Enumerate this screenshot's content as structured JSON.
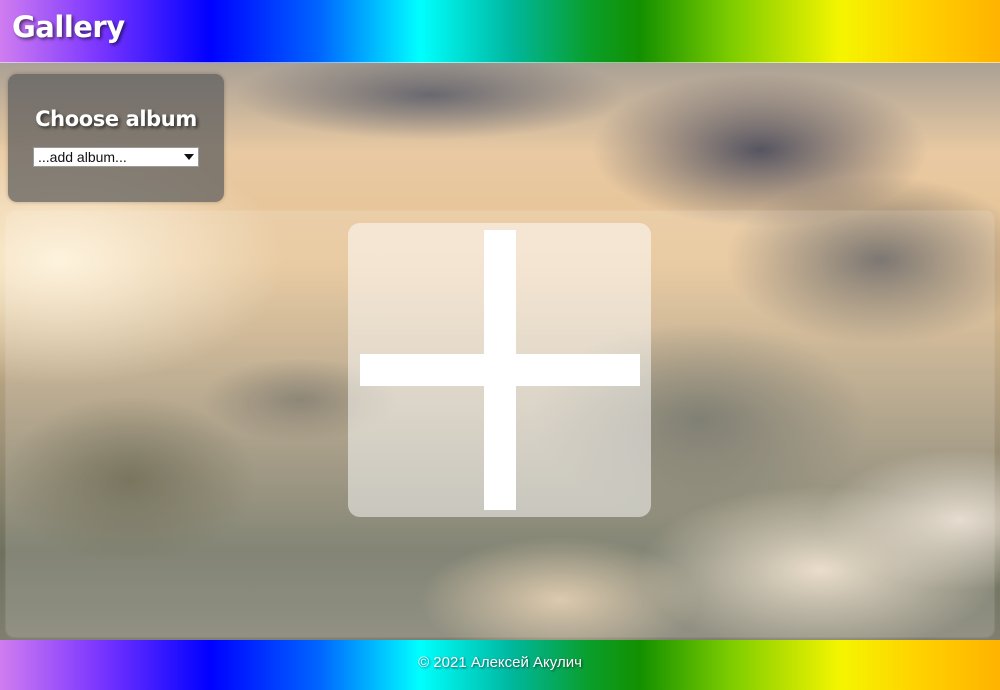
{
  "header": {
    "title": "Gallery"
  },
  "album_panel": {
    "title": "Choose album",
    "select_value": "...add album..."
  },
  "gallery": {
    "add_icon": "plus-icon"
  },
  "footer": {
    "text": "© 2021 Алексей Акулич"
  },
  "colors": {
    "rainbow": [
      "#d07df0",
      "#7a35ff",
      "#0000ff",
      "#0066ff",
      "#00ffff",
      "#00b8a0",
      "#139000",
      "#7ccc00",
      "#f5f500",
      "#ffd100",
      "#ffb300"
    ],
    "panel_background": "#5c5c5c",
    "text_light": "#ffffff"
  }
}
